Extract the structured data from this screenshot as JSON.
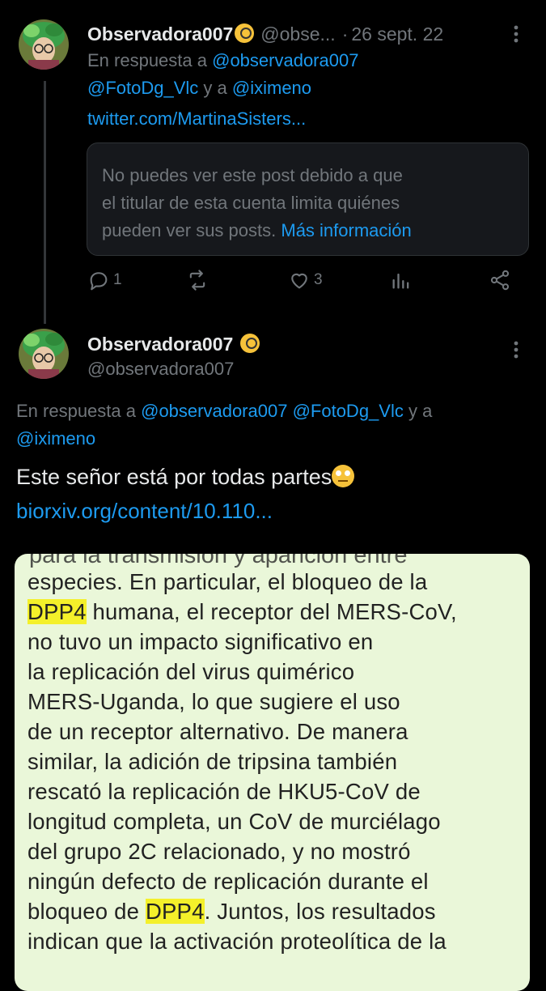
{
  "post1": {
    "display_name": "Observadora007",
    "handle": "@obse...",
    "separator": "·",
    "date": "26 sept. 22",
    "reply_prefix": "En respuesta a",
    "reply_mention1": "@observadora007",
    "reply_mention2": "@FotoDg_Vlc",
    "reply_and": "y a",
    "reply_mention3": "@iximeno",
    "link_text": "twitter.com/MartinaSisters...",
    "restricted_text_1": "No puedes ver este post debido a que",
    "restricted_text_2": "el titular de esta cuenta limita quiénes",
    "restricted_text_3": "pueden ver sus posts.",
    "restricted_link": "Más información",
    "replies_count": "1",
    "likes_count": "3",
    "icons": [
      "reply-icon",
      "retweet-icon",
      "like-icon",
      "views-icon",
      "share-icon",
      "more-icon"
    ]
  },
  "post2": {
    "display_name": "Observadora007",
    "handle": "@observadora007",
    "reply_prefix": "En respuesta a",
    "reply_mention1": "@observadora007",
    "reply_mention2": "@FotoDg_Vlc",
    "reply_and": "y a",
    "reply_mention3": "@iximeno",
    "text": "Este señor está por todas partes",
    "link_text": "biorxiv.org/content/10.110...",
    "icons": [
      "monocle-emoji-icon",
      "eye-roll-emoji-icon",
      "more-icon"
    ]
  },
  "document": {
    "cut_line": "para la transmisión y aparición entre",
    "line1": "especies. En particular, el bloqueo de la",
    "line2_hl": "DPP4",
    "line2_rest": " humana, el receptor del MERS-CoV,",
    "line3": "no tuvo un impacto significativo en",
    "line4": "la replicación del virus quimérico",
    "line5": "MERS-Uganda, lo que sugiere el uso",
    "line6": "de un receptor alternativo. De manera",
    "line7": "similar, la adición de tripsina también",
    "line8": "rescató la replicación de HKU5-CoV de",
    "line9": "longitud completa, un CoV de murciélago",
    "line10": "del grupo 2C relacionado, y no mostró",
    "line11": "ningún defecto de replicación durante el",
    "line12_pre": "bloqueo de ",
    "line12_hl": "DPP4",
    "line12_rest": ". Juntos, los resultados",
    "line13": "indican que la activación proteolítica de la",
    "highlight_color": "#f4f02a",
    "background_color": "#eaf7d9"
  },
  "colors": {
    "background": "#000000",
    "text": "#e7e9ea",
    "muted": "#71767b",
    "link": "#1d9bf0"
  }
}
